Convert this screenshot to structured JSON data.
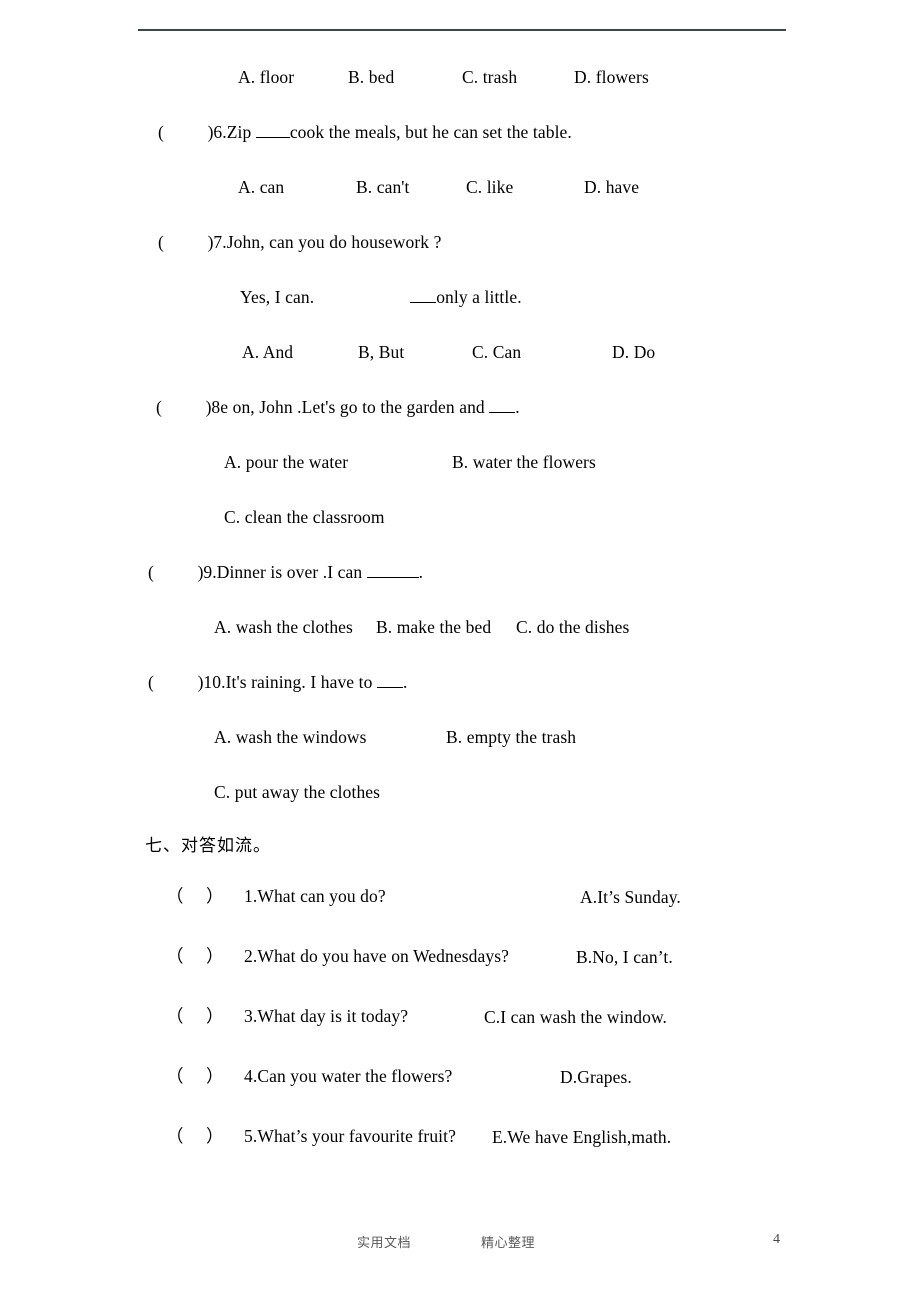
{
  "document": {
    "page_number": "4",
    "rule_color": "#3a4a42"
  },
  "q5_options": {
    "a": "A. floor",
    "b": "B. bed",
    "c": "C. trash",
    "d": "D. flowers"
  },
  "questions": [
    {
      "paren": "(          )",
      "stem_before": "6.Zip ",
      "stem_after": "cook the meals, but he can set the table.",
      "options": [
        "A. can",
        "B. can't",
        "C. like",
        "D. have"
      ]
    },
    {
      "paren": "(          )",
      "stem_before": "7.John, can you do housework ?",
      "stem_after": "",
      "answer_line_before": "Yes, I can.",
      "answer_line_after": "only a little.",
      "options": [
        "A. And",
        "B, But",
        "C. Can",
        "D. Do"
      ]
    },
    {
      "paren": "(          )",
      "stem_before": "8e on, John .Let's go to the garden and ",
      "stem_after": ".",
      "options": [
        "A. pour the water",
        "B. water the flowers",
        "C. clean the classroom"
      ]
    },
    {
      "paren": "(          )",
      "stem_before": "9.Dinner is over .I can ",
      "stem_after": ".",
      "options": [
        "A. wash the clothes",
        "B. make the bed",
        "C. do the dishes"
      ]
    },
    {
      "paren": "(          )",
      "stem_before": "10.It's raining. I have to ",
      "stem_after": ".",
      "options": [
        "A. wash the windows",
        "B. empty the trash",
        "C. put away the clothes"
      ]
    }
  ],
  "section_seven": {
    "heading": "七、对答如流。",
    "items": [
      {
        "paren": "（     ）",
        "prompt": "1.What can you do?",
        "answer": "A.It’s Sunday."
      },
      {
        "paren": "（     ）",
        "prompt": "2.What do you have on Wednesdays?",
        "answer": "B.No, I can’t."
      },
      {
        "paren": "（     ）",
        "prompt": "3.What day is it today?",
        "answer": "C.I can wash the window."
      },
      {
        "paren": "（     ）",
        "prompt": "4.Can you water the flowers?",
        "answer": "D.Grapes."
      },
      {
        "paren": "（     ）",
        "prompt": "5.What’s your favourite fruit?",
        "answer": "E.We have English,math."
      }
    ]
  },
  "footer": {
    "left_label": "实用文档",
    "right_label": "精心整理",
    "page_number": "4"
  }
}
